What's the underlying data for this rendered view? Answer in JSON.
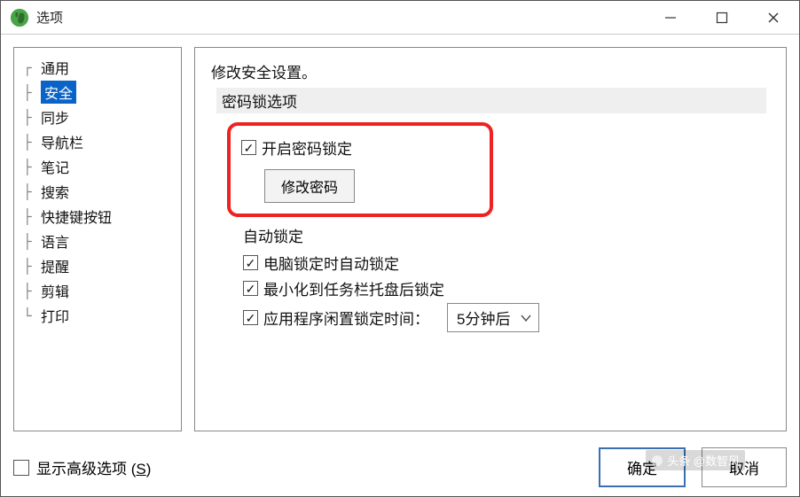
{
  "window": {
    "title": "选项"
  },
  "sidebar": {
    "items": [
      {
        "label": "通用"
      },
      {
        "label": "安全",
        "selected": true
      },
      {
        "label": "同步"
      },
      {
        "label": "导航栏"
      },
      {
        "label": "笔记"
      },
      {
        "label": "搜索"
      },
      {
        "label": "快捷键按钮"
      },
      {
        "label": "语言"
      },
      {
        "label": "提醒"
      },
      {
        "label": "剪辑"
      },
      {
        "label": "打印"
      }
    ]
  },
  "content": {
    "heading": "修改安全设置。",
    "section_password": "密码锁选项",
    "enable_password_lock": "开启密码锁定",
    "change_password_btn": "修改密码",
    "auto_lock_heading": "自动锁定",
    "auto_lock_on_computer_lock": "电脑锁定时自动锁定",
    "auto_lock_on_minimize": "最小化到任务栏托盘后锁定",
    "idle_lock_label": "应用程序闲置锁定时间：",
    "idle_lock_value": "5分钟后"
  },
  "footer": {
    "show_advanced": "显示高级选项 (S)",
    "show_advanced_underline": "S",
    "ok": "确定",
    "cancel": "取消"
  },
  "watermark": "头条 @数智风"
}
